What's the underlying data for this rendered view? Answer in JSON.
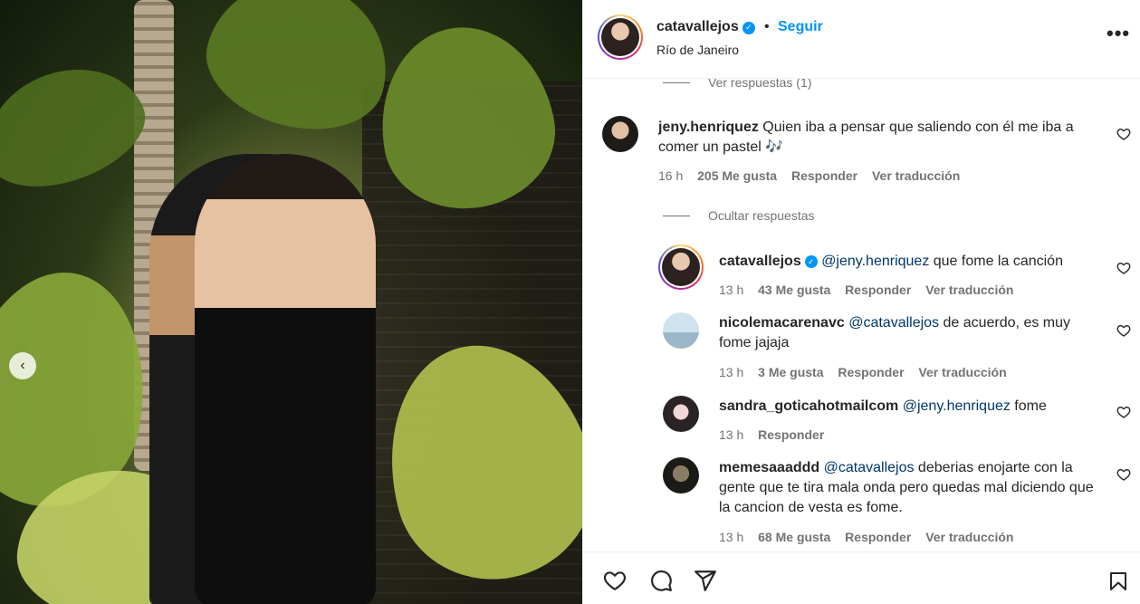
{
  "header": {
    "username": "catavallejos",
    "separator": "•",
    "follow_label": "Seguir",
    "location": "Río de Janeiro",
    "more_label": "•••"
  },
  "photo": {
    "prev_label": "‹"
  },
  "thread": {
    "view_replies": "Ver respuestas (1)",
    "hide_replies": "Ocultar respuestas",
    "comments": [
      {
        "username": "jeny.henriquez",
        "text": "Quien iba a pensar que saliendo con él me iba a comer un pastel 🎶",
        "time": "16 h",
        "likes": "205 Me gusta",
        "reply": "Responder",
        "translate": "Ver traducción"
      }
    ],
    "replies": [
      {
        "username": "catavallejos",
        "mention": "@jeny.henriquez",
        "text": " que fome la canción",
        "time": "13 h",
        "likes": "43 Me gusta",
        "reply": "Responder",
        "translate": "Ver traducción"
      },
      {
        "username": "nicolemacarenavc",
        "mention": "@catavallejos",
        "text": " de acuerdo, es muy fome jajaja",
        "time": "13 h",
        "likes": "3 Me gusta",
        "reply": "Responder",
        "translate": "Ver traducción"
      },
      {
        "username": "sandra_goticahotmailcom",
        "mention": "@jeny.henriquez",
        "text": " fome",
        "time": "13 h",
        "reply": "Responder"
      },
      {
        "username": "memesaaaddd",
        "mention": "@catavallejos",
        "text": " deberias enojarte con la gente que te tira mala onda pero quedas mal diciendo que la cancion de vesta es fome.",
        "time": "13 h",
        "likes": "68 Me gusta",
        "reply": "Responder",
        "translate": "Ver traducción"
      }
    ]
  },
  "colors": {
    "accent": "#0095f6",
    "muted": "#737373",
    "text": "#262626",
    "mention": "#00376b"
  },
  "icons": [
    "heart-icon",
    "comment-icon",
    "share-icon",
    "bookmark-icon",
    "verified-icon",
    "more-icon",
    "chevron-left-icon"
  ]
}
